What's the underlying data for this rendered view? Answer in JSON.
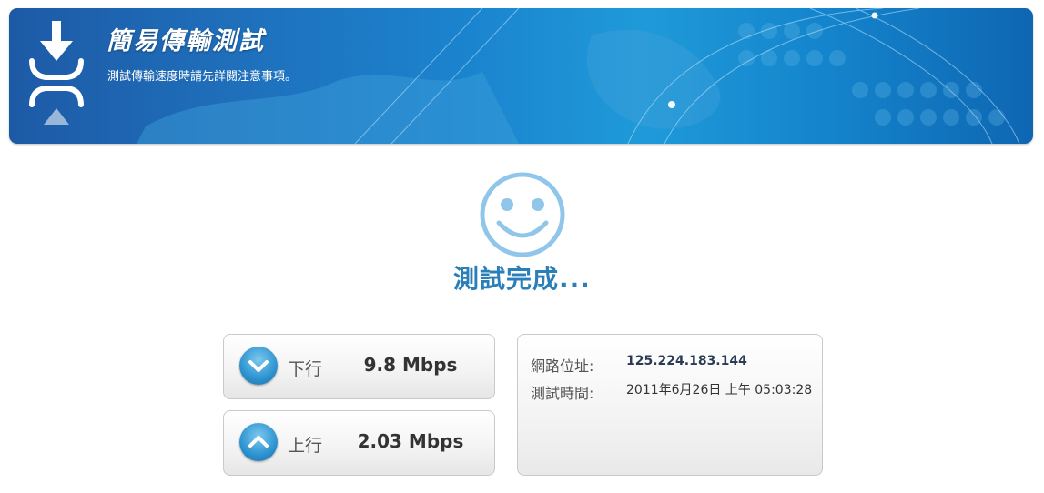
{
  "header": {
    "title": "簡易傳輸測試",
    "subtitle": "測試傳輸速度時請先詳閱注意事項。"
  },
  "status": {
    "text": "測試完成...",
    "icon": "smiley-face-icon"
  },
  "download": {
    "label": "下行",
    "value": "9.8 Mbps",
    "icon": "chevron-down-icon"
  },
  "upload": {
    "label": "上行",
    "value": "2.03 Mbps",
    "icon": "chevron-up-icon"
  },
  "info": {
    "ip_label": "網路位址:",
    "ip_value": "125.224.183.144",
    "time_label": "測試時間:",
    "time_value": "2011年6月26日 上午 05:03:28"
  },
  "colors": {
    "banner_blue": "#1b84cf",
    "accent_blue": "#2a7fb8",
    "smiley_blue": "#8fc6ea"
  }
}
